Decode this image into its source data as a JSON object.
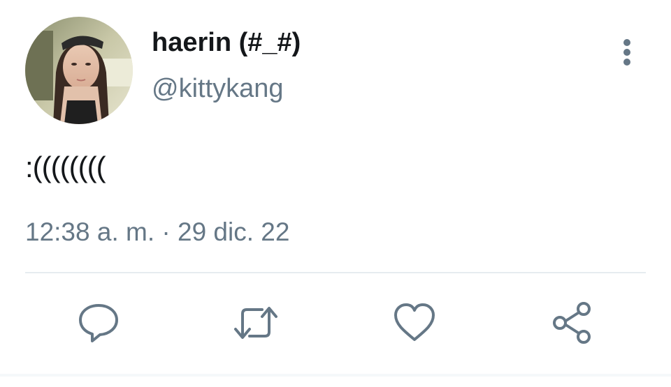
{
  "user": {
    "display_name": "haerin (#_#)",
    "handle": "@kittykang"
  },
  "tweet": {
    "text": ":((((((((",
    "timestamp": "12:38 a. m. · 29 dic. 22"
  },
  "icons": {
    "more": "vertical-dots-icon",
    "reply": "speech-bubble-icon",
    "retweet": "retweet-arrows-icon",
    "like": "heart-outline-icon",
    "share": "share-nodes-icon"
  },
  "colors": {
    "text_primary": "#14171a",
    "text_secondary": "#657786",
    "icon": "#657786",
    "divider": "#e6ecf0"
  }
}
